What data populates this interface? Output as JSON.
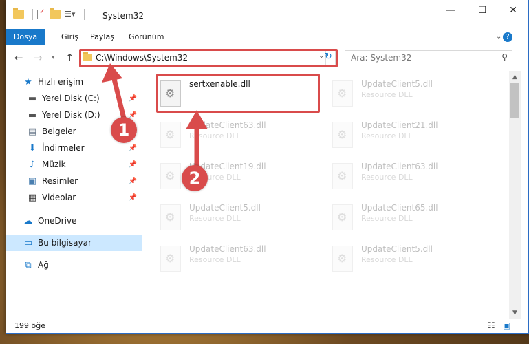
{
  "window": {
    "title": "System32",
    "controls": {
      "minimize": "—",
      "maximize": "☐",
      "close": "✕"
    }
  },
  "ribbon": {
    "tabs": [
      {
        "label": "Dosya"
      },
      {
        "label": "Giriş"
      },
      {
        "label": "Paylaş"
      },
      {
        "label": "Görünüm"
      }
    ]
  },
  "address": {
    "path": "C:\\Windows\\System32",
    "search_placeholder": "Ara: System32"
  },
  "sidebar": {
    "items": [
      {
        "label": "Hızlı erişim",
        "icon": "star-icon",
        "pinned": false
      },
      {
        "label": "Yerel Disk (C:)",
        "icon": "drive-icon",
        "pinned": true
      },
      {
        "label": "Yerel Disk (D:)",
        "icon": "drive-icon",
        "pinned": true
      },
      {
        "label": "Belgeler",
        "icon": "documents-icon",
        "pinned": true
      },
      {
        "label": "İndirmeler",
        "icon": "downloads-icon",
        "pinned": true
      },
      {
        "label": "Müzik",
        "icon": "music-icon",
        "pinned": true
      },
      {
        "label": "Resimler",
        "icon": "pictures-icon",
        "pinned": true
      },
      {
        "label": "Videolar",
        "icon": "videos-icon",
        "pinned": true
      },
      {
        "label": "OneDrive",
        "icon": "cloud-icon",
        "pinned": false
      },
      {
        "label": "Bu bilgisayar",
        "icon": "computer-icon",
        "pinned": false
      },
      {
        "label": "Ağ",
        "icon": "network-icon",
        "pinned": false
      }
    ]
  },
  "files": {
    "highlighted": {
      "name": "sertxenable.dll"
    },
    "faded": [
      {
        "name": "UpdateClient5.dll",
        "type": "Resource DLL"
      },
      {
        "name": "UpdateClient63.dll",
        "type": "Resource DLL"
      },
      {
        "name": "UpdateClient21.dll",
        "type": "Resource DLL"
      },
      {
        "name": "UpdateClient19.dll",
        "type": "Resource DLL"
      },
      {
        "name": "UpdateClient63.dll",
        "type": "Resource DLL"
      },
      {
        "name": "UpdateClient5.dll",
        "type": "Resource DLL"
      },
      {
        "name": "UpdateClient65.dll",
        "type": "Resource DLL"
      },
      {
        "name": "UpdateClient63.dll",
        "type": "Resource DLL"
      },
      {
        "name": "UpdateClient5.dll",
        "type": "Resource DLL"
      }
    ]
  },
  "status": {
    "item_count": "199 öğe"
  },
  "annotations": {
    "step1": "1",
    "step2": "2"
  },
  "colors": {
    "accent": "#1979ca",
    "highlight": "#d94b4b",
    "selected": "#cce8ff"
  }
}
